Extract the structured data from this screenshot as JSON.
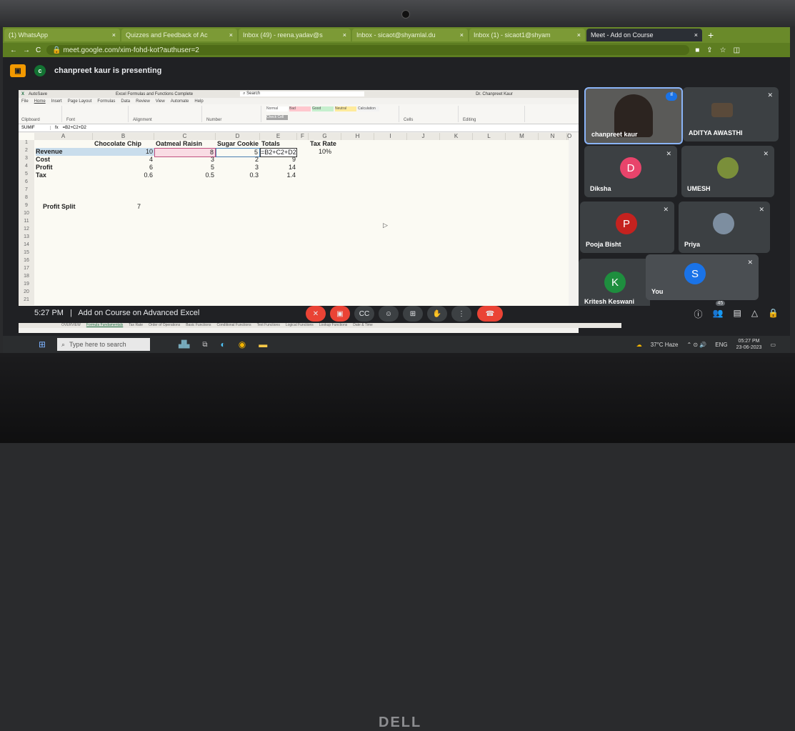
{
  "browser": {
    "tabs": [
      {
        "label": "(1) WhatsApp",
        "active": false
      },
      {
        "label": "Quizzes and Feedback of Ac",
        "active": false
      },
      {
        "label": "Inbox (49) - reena.yadav@s",
        "active": false
      },
      {
        "label": "Inbox - sicaot@shyamlal.du",
        "active": false
      },
      {
        "label": "Inbox (1) - sicaot1@shyam",
        "active": false
      },
      {
        "label": "Meet - Add on Course",
        "active": true
      }
    ],
    "url": "meet.google.com/xim-fohd-kot?authuser=2"
  },
  "meet": {
    "presenting_text": "chanpreet kaur is presenting",
    "presenter_initial": "c",
    "meeting_time": "5:27 PM",
    "separator": "|",
    "meeting_title": "Add on Course on Advanced Excel",
    "participant_count": "45",
    "participants": [
      {
        "name": "chanpreet kaur"
      },
      {
        "name": "ADITYA AWASTHI"
      },
      {
        "name": "Diksha",
        "initial": "D",
        "color": "#e8446b"
      },
      {
        "name": "UMESH"
      },
      {
        "name": "Pooja Bisht",
        "initial": "P",
        "color": "#c5221f"
      },
      {
        "name": "Priya"
      },
      {
        "name": "Kritesh Keswani",
        "initial": "K",
        "color": "#1e8e3e"
      },
      {
        "name": "You",
        "initial": "S",
        "color": "#1a73e8"
      }
    ]
  },
  "excel": {
    "title": "Excel Formulas and Functions Complete",
    "search_placeholder": "Search",
    "user": "Dr. Chanpreet Kaur",
    "menus": [
      "File",
      "Home",
      "Insert",
      "Page Layout",
      "Formulas",
      "Data",
      "Review",
      "View",
      "Automate",
      "Help"
    ],
    "styles": [
      "Normal",
      "Bad",
      "Good",
      "Neutral",
      "Calculation",
      "Check Cell"
    ],
    "name_box": "SUMIF",
    "formula": "=B2+C2+D2",
    "columns": [
      "A",
      "B",
      "C",
      "D",
      "E",
      "F",
      "G",
      "H",
      "I",
      "J",
      "K",
      "L",
      "M",
      "N",
      "O"
    ],
    "rows": [
      "1",
      "2",
      "3",
      "4",
      "5",
      "6",
      "7",
      "8",
      "9",
      "10",
      "11",
      "12",
      "13",
      "14",
      "15",
      "16",
      "17",
      "18",
      "19",
      "20",
      "21"
    ],
    "headers": [
      "Chocolate Chip",
      "Oatmeal Raisin",
      "Sugar Cookie",
      "Totals",
      "Tax Rate"
    ],
    "row_labels": [
      "Revenue",
      "Cost",
      "Profit",
      "Tax"
    ],
    "data": [
      [
        "10",
        "8",
        "5",
        "=B2+C2+D2"
      ],
      [
        "4",
        "3",
        "2",
        "9"
      ],
      [
        "6",
        "5",
        "3",
        "14"
      ],
      [
        "0.6",
        "0.5",
        "0.3",
        "1.4"
      ]
    ],
    "tax_rate": "10%",
    "profit_split_label": "Profit Split",
    "profit_split_value": "7",
    "sheets": [
      "OVERVIEW",
      "Formula Fundamentals",
      "Tax Rate",
      "Order of Operations",
      "Basic Functions",
      "Conditional Functions",
      "Text Functions",
      "Logical Functions",
      "Lookup Functions",
      "Date & Time"
    ]
  },
  "taskbar": {
    "search_placeholder": "Type here to search",
    "weather": "37°C Haze",
    "lang": "ENG",
    "time": "05:27 PM",
    "date": "23-06-2023"
  },
  "laptop": {
    "brand": "DELL"
  }
}
